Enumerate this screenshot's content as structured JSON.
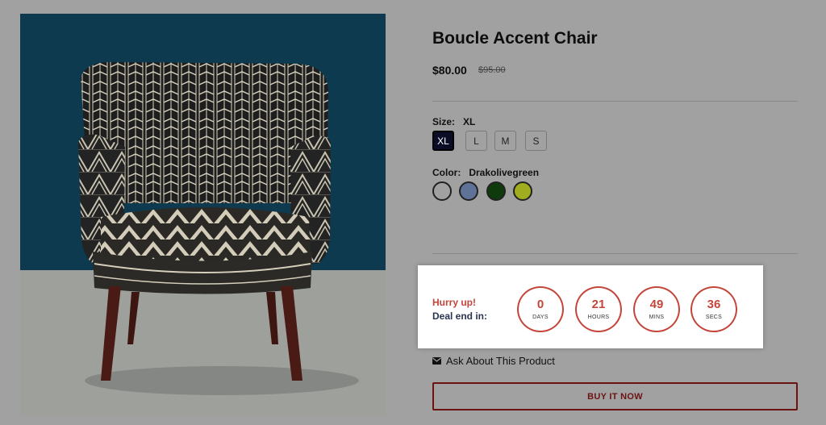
{
  "product": {
    "title": "Boucle Accent Chair",
    "price": "$80.00",
    "old_price": "$95.00"
  },
  "size": {
    "label": "Size:",
    "selected": "XL",
    "options": [
      "XL",
      "L",
      "M",
      "S"
    ]
  },
  "color": {
    "label": "Color:",
    "selected": "Drakolivegreen",
    "swatches": [
      {
        "name": "black",
        "hex": "#a1a1a1"
      },
      {
        "name": "blue",
        "hex": "#5f7297"
      },
      {
        "name": "drakolivegreen",
        "hex": "#0f3a0c"
      },
      {
        "name": "lime",
        "hex": "#9fad1f"
      }
    ]
  },
  "countdown": {
    "hurry": "Hurry up!",
    "deal_end": "Deal end in:",
    "units": [
      {
        "value": "0",
        "label": "DAYS"
      },
      {
        "value": "21",
        "label": "HOURS"
      },
      {
        "value": "49",
        "label": "MINS"
      },
      {
        "value": "36",
        "label": "SECS"
      }
    ],
    "accent": "#c4453a"
  },
  "ask_label": "Ask About This Product",
  "buy_label": "BUY IT NOW"
}
